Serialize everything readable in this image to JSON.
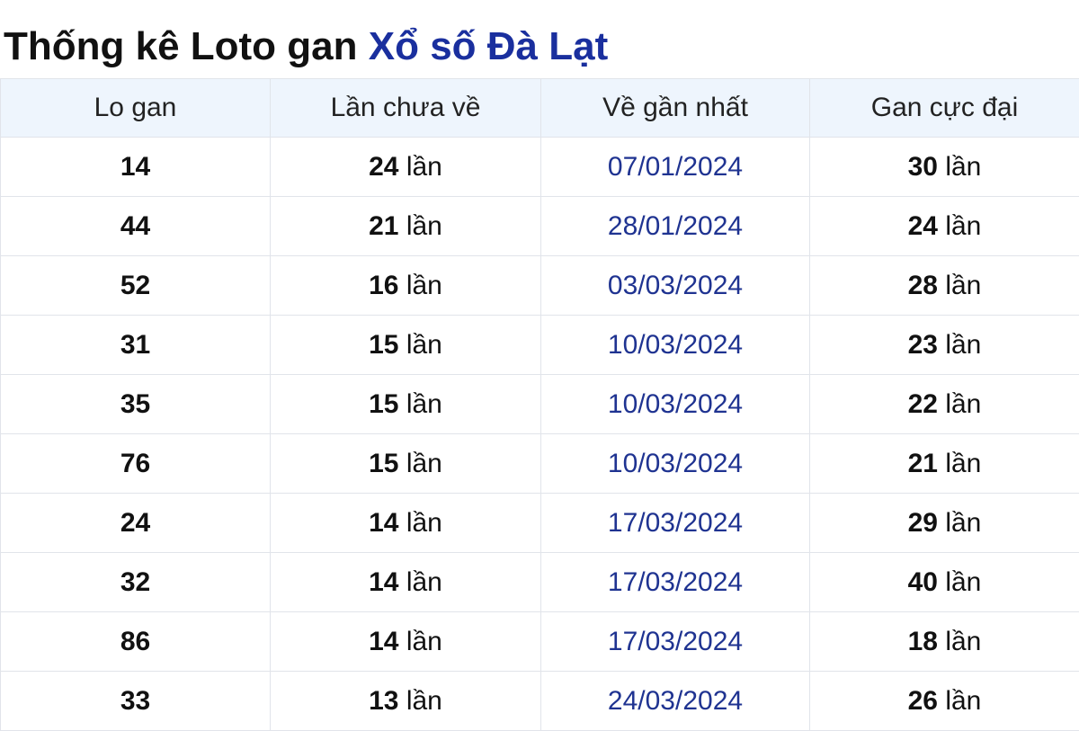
{
  "title": {
    "prefix": "Thống kê Loto gan",
    "accent": "Xổ số Đà Lạt"
  },
  "colors": {
    "accent": "#1a2f9e",
    "date_text": "#1f3391",
    "header_bg": "#eef5fd"
  },
  "table": {
    "headers": [
      "Lo gan",
      "Lần chưa về",
      "Về gần nhất",
      "Gan cực đại"
    ],
    "unit": "lần",
    "rows": [
      {
        "lo": "14",
        "chua_ve": "24",
        "gan_nhat": "07/01/2024",
        "cuc_dai": "30"
      },
      {
        "lo": "44",
        "chua_ve": "21",
        "gan_nhat": "28/01/2024",
        "cuc_dai": "24"
      },
      {
        "lo": "52",
        "chua_ve": "16",
        "gan_nhat": "03/03/2024",
        "cuc_dai": "28"
      },
      {
        "lo": "31",
        "chua_ve": "15",
        "gan_nhat": "10/03/2024",
        "cuc_dai": "23"
      },
      {
        "lo": "35",
        "chua_ve": "15",
        "gan_nhat": "10/03/2024",
        "cuc_dai": "22"
      },
      {
        "lo": "76",
        "chua_ve": "15",
        "gan_nhat": "10/03/2024",
        "cuc_dai": "21"
      },
      {
        "lo": "24",
        "chua_ve": "14",
        "gan_nhat": "17/03/2024",
        "cuc_dai": "29"
      },
      {
        "lo": "32",
        "chua_ve": "14",
        "gan_nhat": "17/03/2024",
        "cuc_dai": "40"
      },
      {
        "lo": "86",
        "chua_ve": "14",
        "gan_nhat": "17/03/2024",
        "cuc_dai": "18"
      },
      {
        "lo": "33",
        "chua_ve": "13",
        "gan_nhat": "24/03/2024",
        "cuc_dai": "26"
      }
    ]
  }
}
